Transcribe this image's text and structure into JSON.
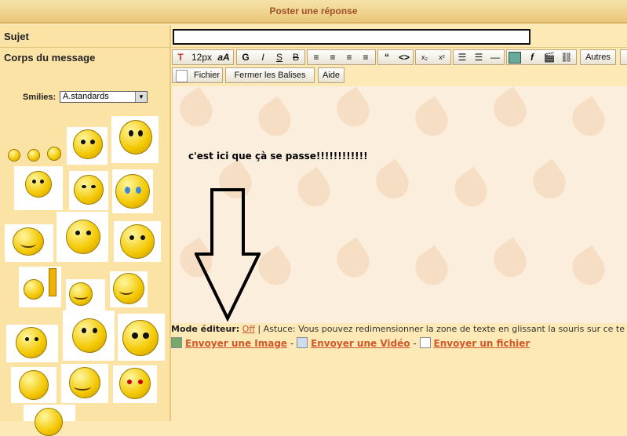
{
  "header": {
    "title": "Poster une réponse"
  },
  "form": {
    "subject_label": "Sujet",
    "body_label": "Corps du message",
    "subject_value": ""
  },
  "smilies": {
    "label": "Smilies:",
    "selected": "A.standards"
  },
  "toolbar": {
    "font_size": "12px",
    "bold": "G",
    "italic": "I",
    "underline": "S",
    "strike": "B",
    "autres_label": "Autres",
    "fichier_label": "Fichier",
    "fermer_label": "Fermer les Balises",
    "aide_label": "Aide"
  },
  "editor": {
    "content": "c'est ici que çà se passe!!!!!!!!!!!!"
  },
  "footer": {
    "mode_label": "Mode éditeur:",
    "mode_value": "Off",
    "tip": "| Astuce: Vous pouvez redimensionner la zone de texte en glissant la souris sur ce te",
    "send_image": "Envoyer une Image",
    "send_video": "Envoyer une Vidéo",
    "send_file": "Envoyer un fichier",
    "separator": "-"
  },
  "colors": {
    "accent": "#d2582a",
    "title": "#a0502a",
    "panel": "#fbe3a6"
  }
}
